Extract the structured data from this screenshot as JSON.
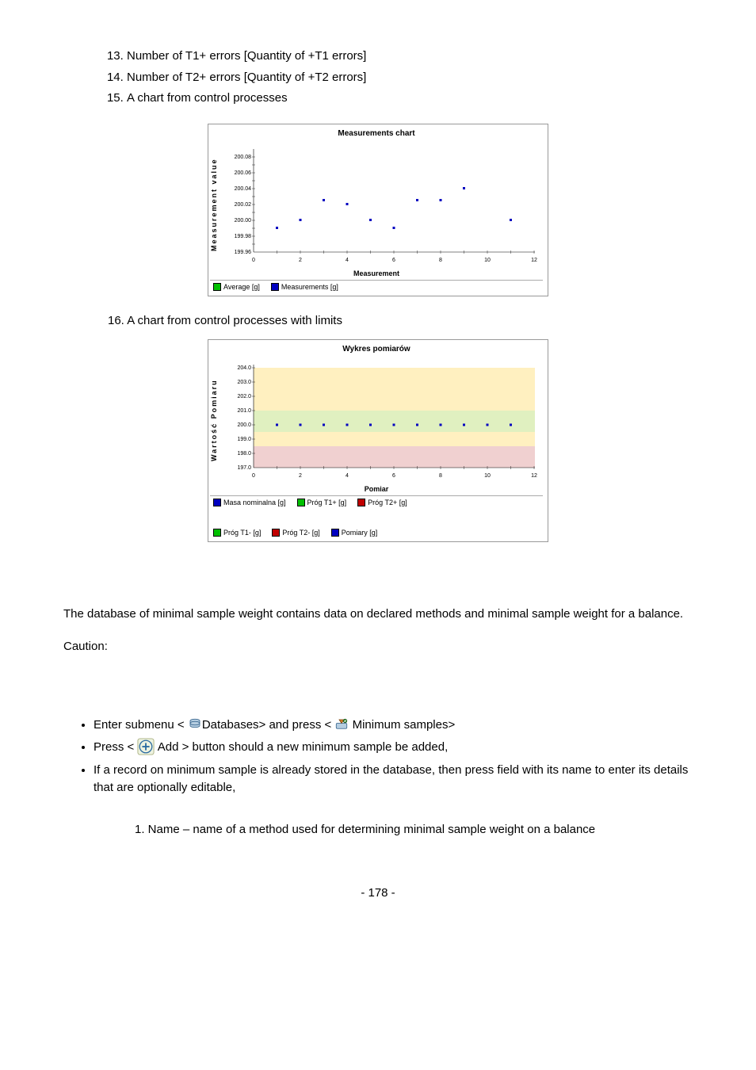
{
  "list": {
    "item13": "Number of T1+ errors  [Quantity of +T1 errors]",
    "item14": "Number of T2+ errors  [Quantity of +T2 errors]",
    "item15": "A chart from control processes",
    "item16": "16. A chart from control processes with limits"
  },
  "chart_data": [
    {
      "type": "scatter",
      "title": "Measurements chart",
      "xlabel": "Measurement",
      "ylabel": "Measurement value",
      "xlim": [
        0,
        12
      ],
      "ylim": [
        199.96,
        200.08
      ],
      "yticks": [
        199.96,
        199.98,
        200.0,
        200.02,
        200.04,
        200.06,
        200.08
      ],
      "xticks": [
        0,
        2,
        4,
        6,
        8,
        10,
        12
      ],
      "series": [
        {
          "name": "Average [g]",
          "color": "#00c000",
          "values": []
        },
        {
          "name": "Measurements [g]",
          "color": "#0000c0",
          "values": [
            {
              "x": 1,
              "y": 199.99
            },
            {
              "x": 2,
              "y": 200.0
            },
            {
              "x": 3,
              "y": 200.025
            },
            {
              "x": 4,
              "y": 200.02
            },
            {
              "x": 5,
              "y": 200.0
            },
            {
              "x": 6,
              "y": 199.99
            },
            {
              "x": 7,
              "y": 200.025
            },
            {
              "x": 8,
              "y": 200.025
            },
            {
              "x": 9,
              "y": 200.04
            },
            {
              "x": 11,
              "y": 200.0
            }
          ]
        }
      ]
    },
    {
      "type": "scatter",
      "title": "Wykres pomiarów",
      "xlabel": "Pomiar",
      "ylabel": "Wartość Pomiaru",
      "xlim": [
        0,
        12
      ],
      "ylim": [
        197,
        204
      ],
      "yticks": [
        197,
        198,
        199,
        200,
        201,
        202,
        203,
        204
      ],
      "xticks": [
        0,
        2,
        4,
        6,
        8,
        10,
        12
      ],
      "bands": [
        {
          "from": 201,
          "to": 204,
          "color": "#fff0c0"
        },
        {
          "from": 199.5,
          "to": 201,
          "color": "#e0f0c0"
        },
        {
          "from": 198.5,
          "to": 199.5,
          "color": "#fff0c0"
        },
        {
          "from": 197,
          "to": 198.5,
          "color": "#f0d0d0"
        }
      ],
      "series": [
        {
          "name": "Masa nominalna [g]",
          "color": "#0000c0"
        },
        {
          "name": "Próg T1+ [g]",
          "color": "#00c000"
        },
        {
          "name": "Próg T2+ [g]",
          "color": "#c00000"
        },
        {
          "name": "Próg T1- [g]",
          "color": "#00c000"
        },
        {
          "name": "Próg T2- [g]",
          "color": "#c00000"
        },
        {
          "name": "Pomiary [g]",
          "color": "#0000c0",
          "values": [
            {
              "x": 1,
              "y": 200
            },
            {
              "x": 2,
              "y": 200
            },
            {
              "x": 3,
              "y": 200
            },
            {
              "x": 4,
              "y": 200
            },
            {
              "x": 5,
              "y": 200
            },
            {
              "x": 6,
              "y": 200
            },
            {
              "x": 7,
              "y": 200
            },
            {
              "x": 8,
              "y": 200
            },
            {
              "x": 9,
              "y": 200
            },
            {
              "x": 10,
              "y": 200
            },
            {
              "x": 11,
              "y": 200
            }
          ]
        }
      ]
    }
  ],
  "body": {
    "para": "The database of minimal sample weight contains data on declared methods and minimal sample weight for a balance.",
    "caution": "Caution:",
    "bullet1a": "Enter submenu < ",
    "bullet1b": "Databases> and press < ",
    "bullet1c": " Minimum samples>",
    "bullet2a": "Press < ",
    "bullet2b": " Add > button should a new minimum sample be added,",
    "bullet3": "If a record on minimum sample is already stored in the database, then press field with its name to enter its details that are optionally editable,",
    "sub1": "1. Name – name of a method used for determining minimal sample weight on a balance"
  },
  "footer": "- 178 -",
  "icons": {
    "databases": "databases-icon",
    "minimum": "minimum-samples-icon",
    "add": "add-icon"
  }
}
